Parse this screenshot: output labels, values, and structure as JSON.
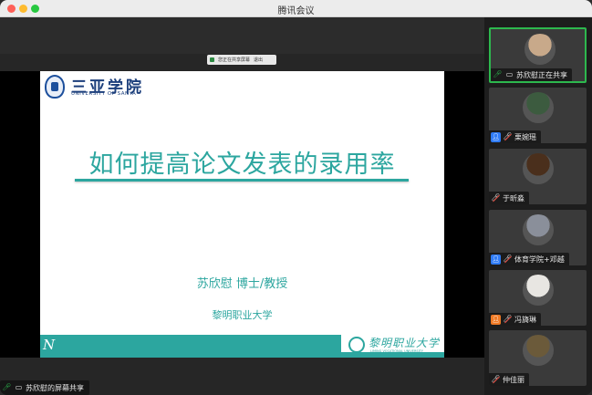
{
  "window": {
    "title": "腾讯会议"
  },
  "share_strip": {
    "text": "您正在共享屏幕",
    "extra": "退出"
  },
  "slide": {
    "university_cn": "三亚学院",
    "university_en": "UNIVERSITY OF SANYA",
    "title": "如何提高论文发表的录用率",
    "presenter": "苏欣慰  博士/教授",
    "institution": "黎明职业大学",
    "footer_letter": "N",
    "footer_logo_cn": "黎明职业大学",
    "footer_logo_en": "LIMING VOCATIONAL UNIVERSITY"
  },
  "bottom_label": {
    "text": "苏欣慰的屏幕共享",
    "icons": [
      "mic-on-icon",
      "screen-share-icon"
    ]
  },
  "participants": [
    {
      "name": "苏欣慰正在共享",
      "mic": "on",
      "host_badge": false,
      "sharing": true,
      "active": true,
      "avatar_color": "#c8a98a"
    },
    {
      "name": "栗婉瑶",
      "mic": "off",
      "host_badge": true,
      "sharing": false,
      "active": false,
      "avatar_color": "#3c5b3f"
    },
    {
      "name": "于昕淼",
      "mic": "off",
      "host_badge": false,
      "sharing": false,
      "active": false,
      "avatar_color": "#4a2f1c"
    },
    {
      "name": "体育学院+邓越",
      "mic": "off",
      "host_badge": true,
      "sharing": false,
      "active": false,
      "avatar_color": "#8a8f9a"
    },
    {
      "name": "冯旖琳",
      "mic": "off",
      "host_badge": true,
      "sharing": false,
      "active": false,
      "avatar_color": "#e8e6e2"
    },
    {
      "name": "仲佳丽",
      "mic": "off",
      "host_badge": false,
      "sharing": false,
      "active": false,
      "avatar_color": "#6b5a3a"
    }
  ],
  "colors": {
    "accent": "#2ca69f",
    "active_border": "#2db84e",
    "brand_blue": "#1c3f7c"
  }
}
